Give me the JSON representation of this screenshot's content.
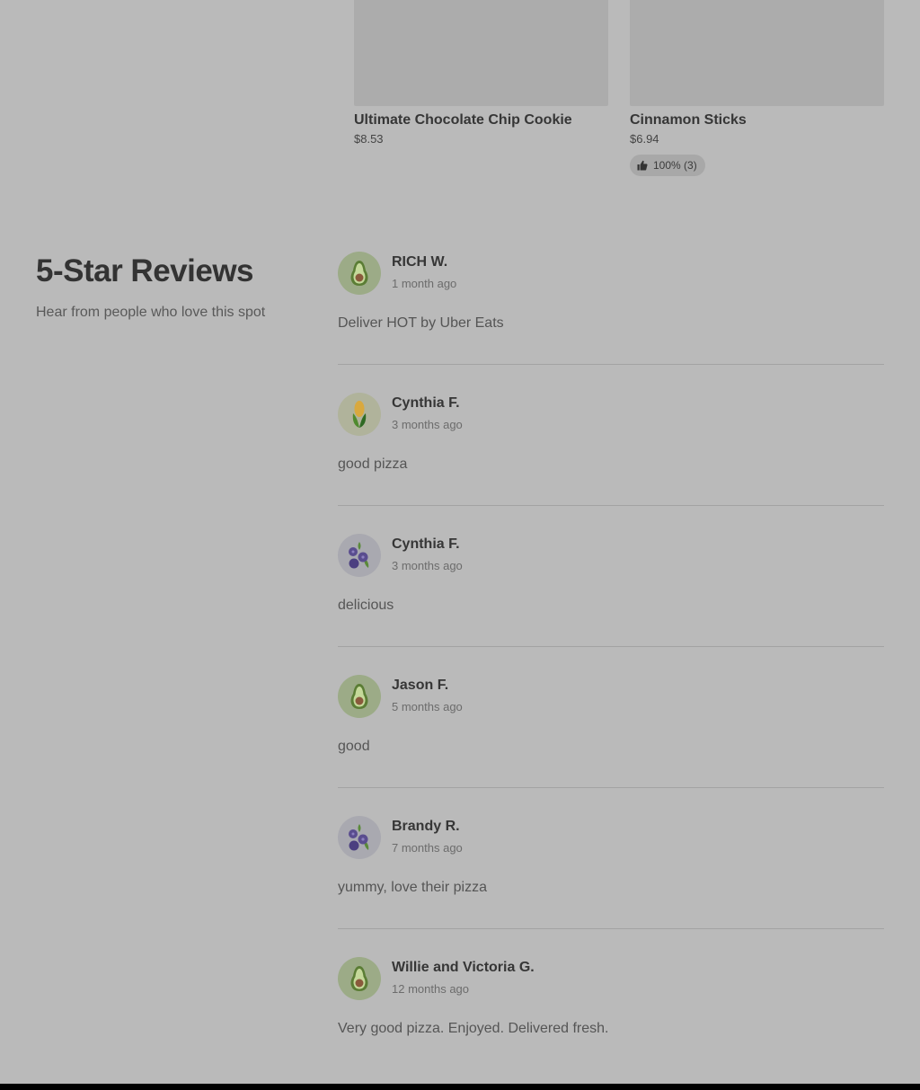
{
  "products": [
    {
      "name": "Ultimate Chocolate Chip Cookie",
      "price": "$8.53",
      "rating": ""
    },
    {
      "name": "Cinnamon Sticks",
      "price": "$6.94",
      "rating": "100% (3)"
    }
  ],
  "reviews_section": {
    "title": "5-Star Reviews",
    "subtitle": "Hear from people who love this spot",
    "items": [
      {
        "name": "RICH W.",
        "date": "1 month ago",
        "text": "Deliver HOT by Uber Eats",
        "avatar": "avocado-icon"
      },
      {
        "name": "Cynthia F.",
        "date": "3 months ago",
        "text": "good pizza",
        "avatar": "corn-icon"
      },
      {
        "name": "Cynthia F.",
        "date": "3 months ago",
        "text": "delicious",
        "avatar": "blueberries-icon"
      },
      {
        "name": "Jason F.",
        "date": "5 months ago",
        "text": "good",
        "avatar": "avocado-icon"
      },
      {
        "name": "Brandy R.",
        "date": "7 months ago",
        "text": "yummy, love their pizza",
        "avatar": "blueberries-icon"
      },
      {
        "name": "Willie and Victoria G.",
        "date": "12 months ago",
        "text": "Very good pizza. Enjoyed. Delivered fresh.",
        "avatar": "avocado-icon"
      }
    ]
  }
}
